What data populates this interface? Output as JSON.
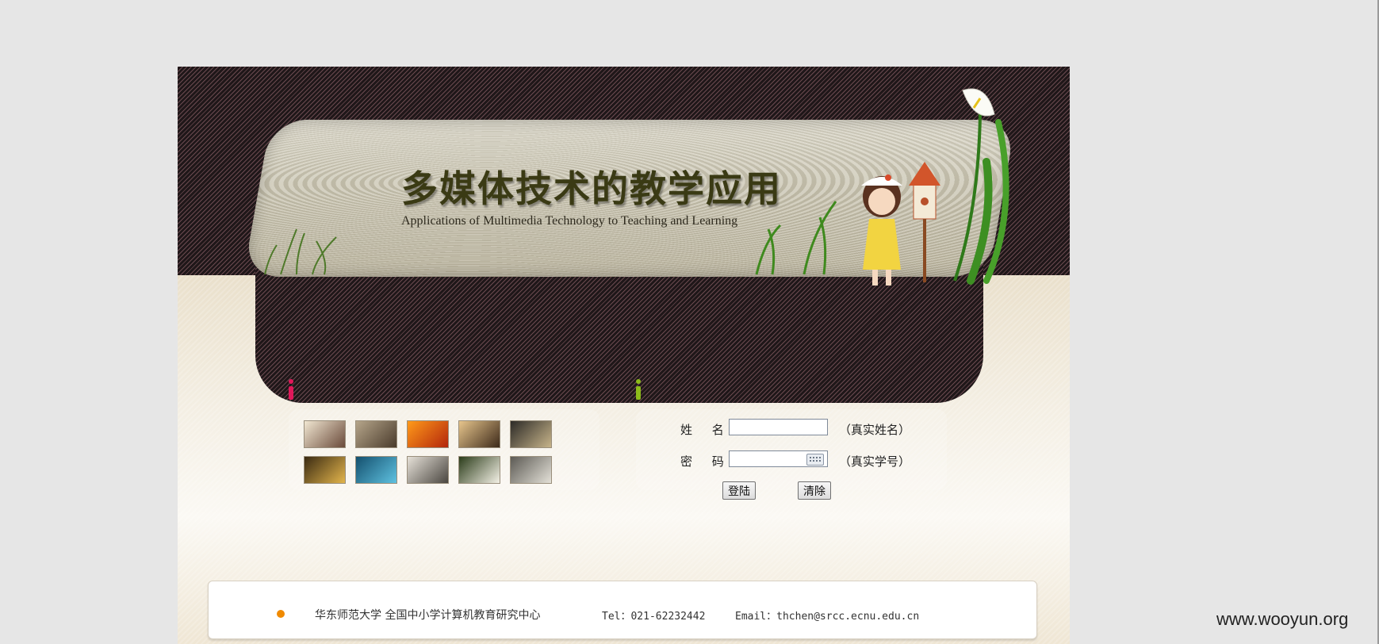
{
  "banner": {
    "title": "多媒体技术的教学应用",
    "subtitle": "Applications of  Multimedia Technology to Teaching and Learning"
  },
  "gallery": {
    "icon": "info-icon",
    "icon_color": "#e0185a",
    "thumbnails": [
      {
        "name": "thumb-gallery-hall",
        "colors": [
          "#f1e7d2",
          "#6a4a3a"
        ]
      },
      {
        "name": "thumb-corridor",
        "colors": [
          "#b5a58a",
          "#4a3b2c"
        ]
      },
      {
        "name": "thumb-orange-lamp",
        "colors": [
          "#ff9a1a",
          "#b3260c"
        ]
      },
      {
        "name": "thumb-exhibit-room",
        "colors": [
          "#e7c58c",
          "#3d2a1a"
        ]
      },
      {
        "name": "thumb-night-building",
        "colors": [
          "#2c2a27",
          "#c7b48a"
        ]
      },
      {
        "name": "thumb-gold-sculpture",
        "colors": [
          "#3a2a12",
          "#e3b54c"
        ]
      },
      {
        "name": "thumb-blue-aquarium",
        "colors": [
          "#14506e",
          "#5fc2e1"
        ]
      },
      {
        "name": "thumb-ceramic-bowl",
        "colors": [
          "#e6e1d8",
          "#4a4640"
        ]
      },
      {
        "name": "thumb-white-flowers",
        "colors": [
          "#2b3c1a",
          "#f4f1e6"
        ]
      },
      {
        "name": "thumb-staircase",
        "colors": [
          "#5c5a54",
          "#e4e1d8"
        ]
      }
    ]
  },
  "login": {
    "icon": "info-icon",
    "icon_color": "#8dbb1a",
    "name_label": "姓 名",
    "name_value": "",
    "name_hint": "（真实姓名）",
    "password_label": "密 码",
    "password_value": "",
    "password_hint": "（真实学号）",
    "keyboard_icon": "keyboard-icon",
    "login_button": "登陆",
    "clear_button": "清除"
  },
  "footer": {
    "bullet_color": "#f08a00",
    "org": "华东师范大学  全国中小学计算机教育研究中心",
    "tel": "Tel：021-62232442",
    "email": "Email：thchen@srcc.ecnu.edu.cn"
  },
  "watermark": "www.wooyun.org"
}
